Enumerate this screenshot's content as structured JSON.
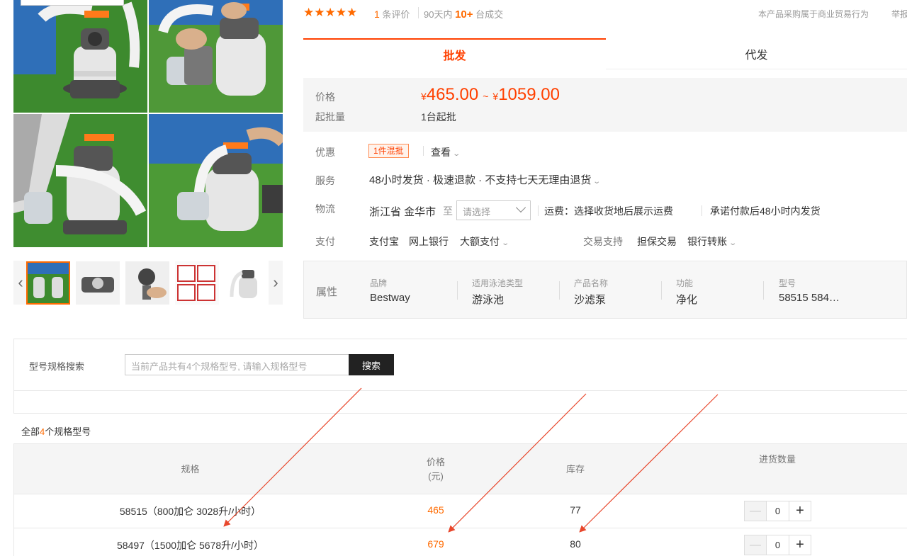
{
  "header": {
    "stars": "★★★★★",
    "rating_count": "1",
    "rating_suffix": "条评价",
    "deals_prefix": "90天内",
    "deals_count": "10+",
    "deals_suffix": "台成交",
    "trade_note": "本产品采购属于商业贸易行为",
    "report": "举报"
  },
  "tabs": [
    {
      "label": "批发",
      "active": true
    },
    {
      "label": "代发",
      "active": false
    }
  ],
  "price": {
    "label": "价格",
    "currency": "¥",
    "min": "465.00",
    "tilde": "~",
    "max": "1059.00",
    "min_order_label": "起批量",
    "min_order_value": "1台起批"
  },
  "promo": {
    "label": "优惠",
    "tag": "1件混批",
    "view": "查看"
  },
  "service": {
    "label": "服务",
    "text": "48小时发货 · 极速退款 · 不支持七天无理由退货"
  },
  "logistics": {
    "label": "物流",
    "from": "浙江省 金华市",
    "to_label": "至",
    "select_placeholder": "请选择",
    "freight": "运费：选择收货地后展示运费",
    "promise": "承诺付款后48小时内发货"
  },
  "payment": {
    "label": "支付",
    "methods": [
      "支付宝",
      "网上银行",
      "大额支付"
    ],
    "trade_support_label": "交易支持",
    "trade_support": [
      "担保交易",
      "银行转账"
    ]
  },
  "attributes": {
    "label": "属性",
    "items": [
      {
        "k": "品牌",
        "v": "Bestway"
      },
      {
        "k": "适用泳池类型",
        "v": "游泳池"
      },
      {
        "k": "产品名称",
        "v": "沙滤泵"
      },
      {
        "k": "功能",
        "v": "净化"
      },
      {
        "k": "型号",
        "v": "58515 584…"
      }
    ]
  },
  "spec_search": {
    "label": "型号规格搜索",
    "placeholder": "当前产品共有4个规格型号, 请输入规格型号",
    "button": "搜索"
  },
  "all_specs": {
    "prefix": "全部",
    "count": "4",
    "suffix": "个规格型号"
  },
  "table": {
    "headers": {
      "spec": "规格",
      "price": "价格",
      "price_unit": "(元)",
      "stock": "库存",
      "qty": "进货数量"
    },
    "rows": [
      {
        "spec": "58515（800加仑 3028升/小时）",
        "price": "465",
        "stock": "77",
        "qty": "0"
      },
      {
        "spec": "58497（1500加仑 5678升/小时）",
        "price": "679",
        "stock": "80",
        "qty": "0"
      }
    ]
  },
  "colors": {
    "accent": "#ff4000",
    "orange": "#ff6a00",
    "annotation": "#e8472c"
  }
}
